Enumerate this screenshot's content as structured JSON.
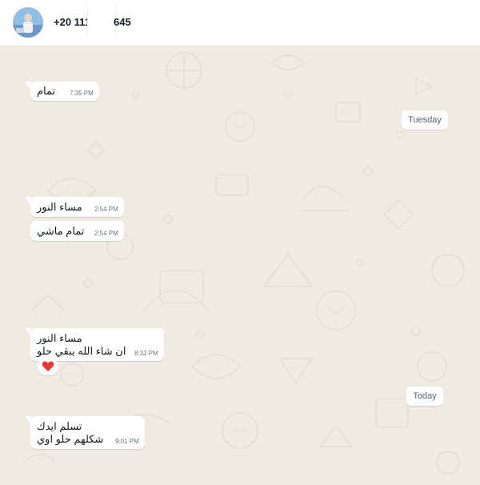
{
  "header": {
    "contact_phone_prefix": "+20 111",
    "contact_phone_suffix": "645",
    "avatar": "contact-avatar"
  },
  "chat": {
    "background_color": "#efeae2",
    "day_separators": [
      {
        "label": "Tuesday"
      },
      {
        "label": "Today"
      }
    ],
    "messages": [
      {
        "lines": [
          "تمام"
        ],
        "time": "7:35 PM"
      },
      {
        "lines": [
          "مساء النور"
        ],
        "time": "2:54 PM"
      },
      {
        "lines": [
          "تمام ماشي"
        ],
        "time": "2:54 PM"
      },
      {
        "lines": [
          "مساء النور",
          "ان شاء الله يبقي حلو"
        ],
        "time": "8:32 PM",
        "reaction": "heart-icon"
      },
      {
        "lines": [
          "تسلم ايدك",
          "شكلهم حلو اوي"
        ],
        "time": "9:01 PM"
      }
    ]
  },
  "colors": {
    "bubble_incoming": "#ffffff",
    "text_primary": "#111b21",
    "text_meta": "#667781",
    "reaction_heart": "#e53935"
  }
}
